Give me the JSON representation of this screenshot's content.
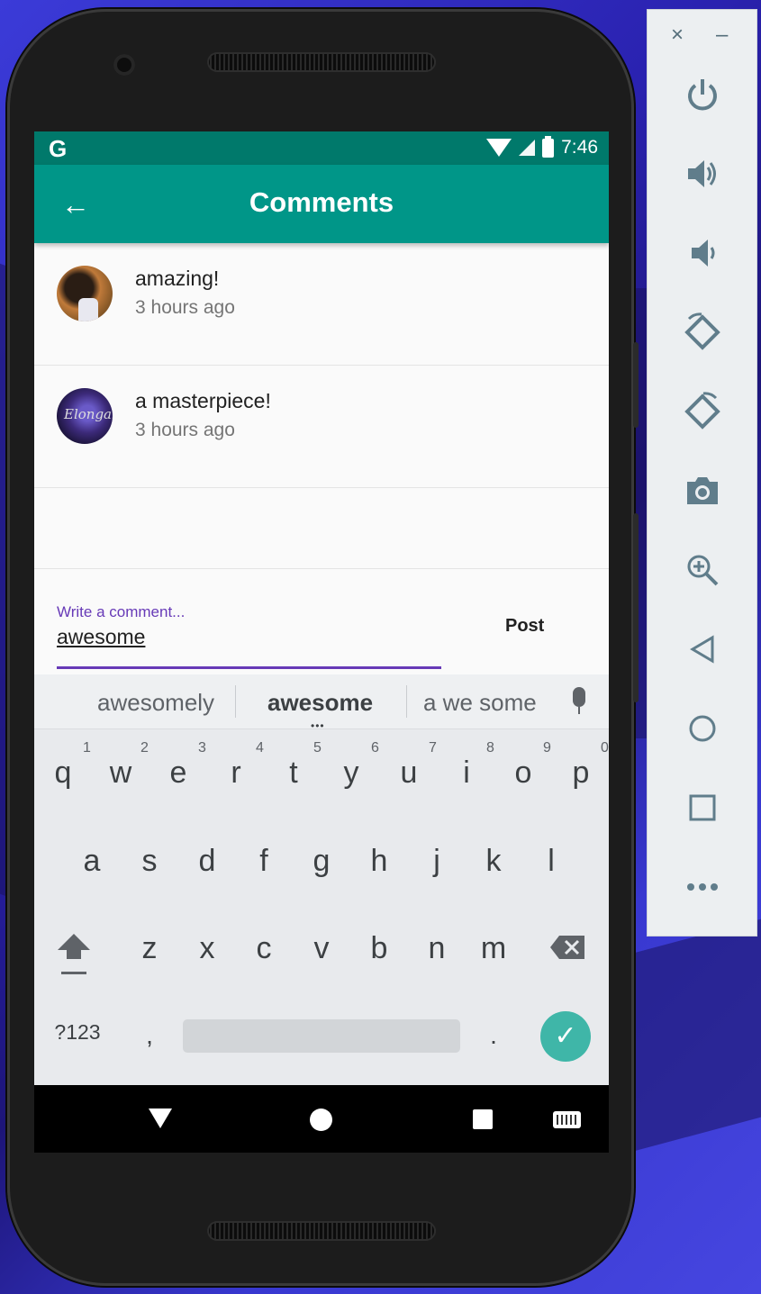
{
  "status_bar": {
    "left_icon": "G",
    "time": "7:46"
  },
  "app_bar": {
    "title": "Comments",
    "back_icon": "arrow-left-icon"
  },
  "comments": [
    {
      "text": "amazing!",
      "time": "3 hours ago"
    },
    {
      "text": "a masterpiece!",
      "time": "3 hours ago"
    }
  ],
  "comment_input": {
    "label": "Write a comment...",
    "value": "awesome",
    "post_label": "Post"
  },
  "keyboard": {
    "suggestions": [
      "awesomely",
      "awesome",
      "a we some"
    ],
    "row1": [
      "q",
      "w",
      "e",
      "r",
      "t",
      "y",
      "u",
      "i",
      "o",
      "p"
    ],
    "row1_nums": [
      "1",
      "2",
      "3",
      "4",
      "5",
      "6",
      "7",
      "8",
      "9",
      "0"
    ],
    "row2": [
      "a",
      "s",
      "d",
      "f",
      "g",
      "h",
      "j",
      "k",
      "l"
    ],
    "row3": [
      "z",
      "x",
      "c",
      "v",
      "b",
      "n",
      "m"
    ],
    "symbols_label": "?123",
    "comma": ",",
    "period": ".",
    "enter_icon": "check-icon"
  },
  "emulator_panel": {
    "close": "×",
    "minimize": "–",
    "buttons": [
      "power-icon",
      "volume-up-icon",
      "volume-down-icon",
      "rotate-left-icon",
      "rotate-right-icon",
      "camera-icon",
      "zoom-icon",
      "back-icon",
      "home-icon",
      "overview-icon",
      "more-icon"
    ]
  },
  "colors": {
    "status_bar": "#00796b",
    "app_bar": "#009688",
    "accent": "#673ab7",
    "enter": "#3fb6a8"
  }
}
